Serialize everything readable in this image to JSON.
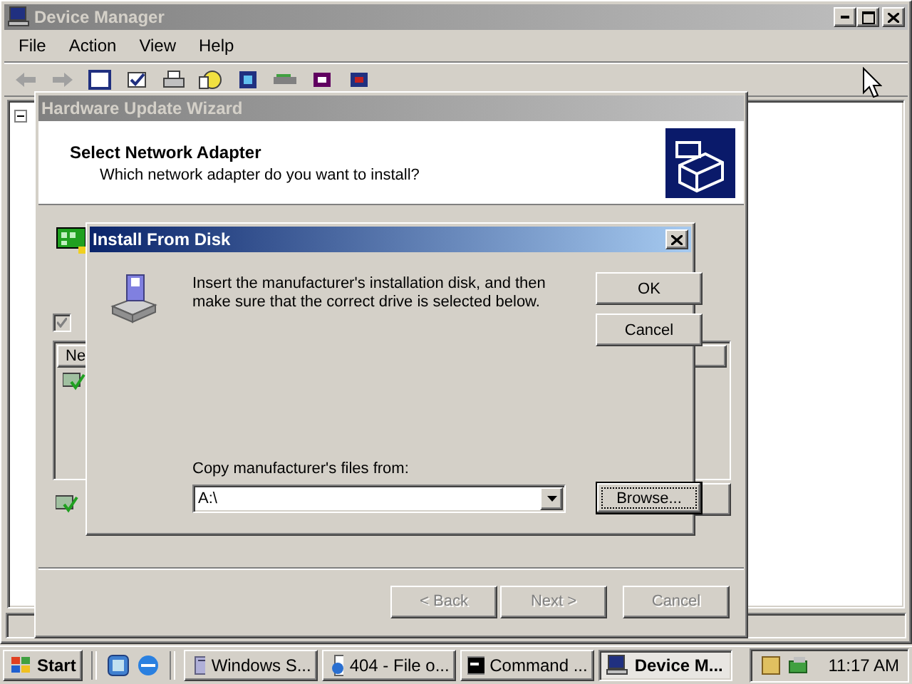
{
  "device_manager": {
    "title": "Device Manager",
    "active": false,
    "menu": [
      "File",
      "Action",
      "View",
      "Help"
    ]
  },
  "wizard": {
    "title": "Hardware Update Wizard",
    "active": false,
    "heading": "Select Network Adapter",
    "subheading": "Which network adapter do you want to install?",
    "show_compatible": {
      "checked": true,
      "disabled": true
    },
    "list_column": "Ne",
    "buttons": [
      {
        "label": "< Back",
        "disabled": true
      },
      {
        "label": "Next >",
        "disabled": true
      },
      {
        "label": "Cancel",
        "disabled": true
      }
    ]
  },
  "install_dialog": {
    "title": "Install From Disk",
    "active": true,
    "message_lines": [
      "Insert the manufacturer's installation disk, and then",
      "make sure that the correct drive is selected below."
    ],
    "buttons": [
      {
        "label": "OK"
      },
      {
        "label": "Cancel"
      }
    ],
    "copy_label": "Copy manufacturer's files from:",
    "path": "A:\\",
    "browse": {
      "label": "Browse...",
      "focused": true
    }
  },
  "taskbar": {
    "start": "Start",
    "tasks": [
      {
        "label": "Windows S...",
        "kind": "server",
        "selected": false
      },
      {
        "label": "404 - File o...",
        "kind": "page",
        "selected": false
      },
      {
        "label": "Command ...",
        "kind": "console",
        "selected": false
      },
      {
        "label": "Device M...",
        "kind": "computer",
        "selected": true
      }
    ],
    "clock": "11:17 AM"
  }
}
